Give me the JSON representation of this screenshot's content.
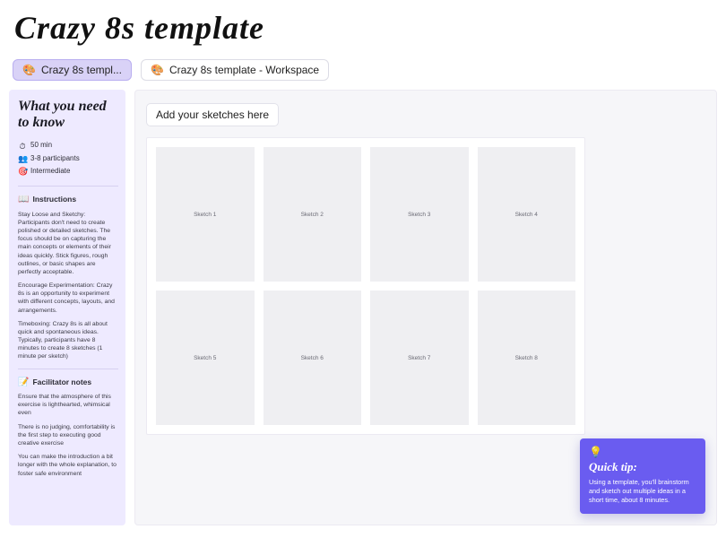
{
  "header": {
    "title": "Crazy 8s template"
  },
  "tabs": [
    {
      "icon": "🎨",
      "label": "Crazy 8s templ..."
    },
    {
      "icon": "🎨",
      "label": "Crazy 8s template - Workspace"
    }
  ],
  "sidebar": {
    "title": "What you need to know",
    "meta": {
      "duration_icon": "⏱",
      "duration": "50 min",
      "participants_icon": "👥",
      "participants": "3-8 participants",
      "level_icon": "🎯",
      "level": "Intermediate"
    },
    "instructions": {
      "icon": "📖",
      "heading": "Instructions",
      "paras": [
        "Stay Loose and Sketchy: Participants don't need to create polished or detailed sketches. The focus should be on capturing the main concepts or elements of their ideas quickly. Stick figures, rough outlines, or basic shapes are perfectly acceptable.",
        "Encourage Experimentation: Crazy 8s is an opportunity to experiment with different concepts, layouts, and arrangements.",
        "Timeboxing: Crazy 8s is all about quick and spontaneous ideas. Typically, participants have 8 minutes to create 8 sketches (1 minute per sketch)"
      ]
    },
    "facilitator": {
      "icon": "📝",
      "heading": "Facilitator notes",
      "paras": [
        "Ensure that the atmosphere of this exercise is lighthearted, whimsical even",
        "There is no judging, comfortability is the first step to executing good creative exercise",
        "You can make the introduction a bit longer with the whole explanation, to foster safe environment"
      ]
    }
  },
  "workspace": {
    "prompt": "Add your sketches here",
    "sketches": [
      "Sketch 1",
      "Sketch 2",
      "Sketch 3",
      "Sketch 4",
      "Sketch 5",
      "Sketch 6",
      "Sketch 7",
      "Sketch 8"
    ]
  },
  "tip": {
    "icon": "💡",
    "title": "Quick tip:",
    "body": "Using a template, you'll brainstorm and sketch out multiple ideas in a short time, about 8 minutes."
  }
}
